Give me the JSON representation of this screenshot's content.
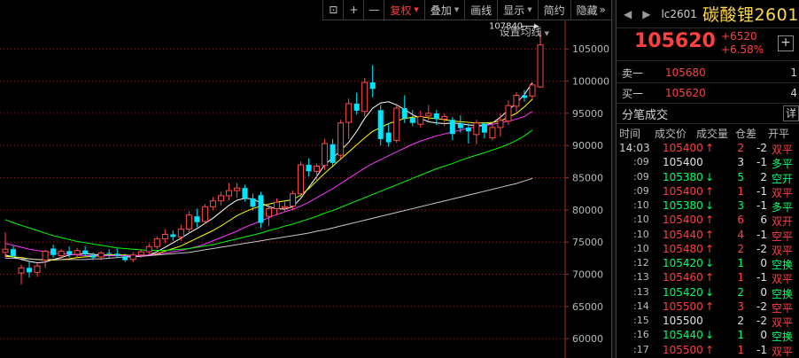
{
  "toolbar": {
    "items": [
      {
        "name": "lock-icon",
        "label": "⊡",
        "square": true
      },
      {
        "name": "zoom-in-button",
        "label": "+",
        "square": true
      },
      {
        "name": "zoom-out-button",
        "label": "—",
        "square": true
      },
      {
        "name": "adjust-dropdown",
        "label": "复权",
        "caret": true,
        "active": true
      },
      {
        "name": "overlay-dropdown",
        "label": "叠加",
        "caret": true
      },
      {
        "name": "draw-button",
        "label": "画线"
      },
      {
        "name": "display-dropdown",
        "label": "显示",
        "caret": true
      },
      {
        "name": "contract-button",
        "label": "简约"
      },
      {
        "name": "hide-button",
        "label": "隐藏",
        "chevrons": "»"
      }
    ]
  },
  "chart": {
    "ma_settings_label": "设置均线",
    "peak_label": "107840",
    "price_ticks": [
      "105000",
      "100000",
      "95000",
      "90000",
      "85000",
      "80000",
      "75000",
      "70000",
      "65000",
      "60000"
    ]
  },
  "chart_data": {
    "type": "candlestick",
    "y_range": [
      57000,
      111500
    ],
    "colors": {
      "up": "#ff4b4b",
      "down": "#00e5ff",
      "ma5": "#ffffff",
      "ma10": "#ffff00",
      "ma20": "#ff33ff",
      "ma40": "#00ff00",
      "ma60": "#c8c8c8",
      "grid": "#8a2a2a"
    },
    "candles": [
      {
        "o": 73400,
        "h": 76500,
        "l": 72500,
        "c": 73900
      },
      {
        "o": 73900,
        "h": 74400,
        "l": 72600,
        "c": 72800
      },
      {
        "o": 70200,
        "h": 71500,
        "l": 68400,
        "c": 71000
      },
      {
        "o": 71000,
        "h": 72000,
        "l": 69500,
        "c": 70300
      },
      {
        "o": 70300,
        "h": 71800,
        "l": 69600,
        "c": 71300
      },
      {
        "o": 72200,
        "h": 73800,
        "l": 71000,
        "c": 73600
      },
      {
        "o": 74000,
        "h": 74600,
        "l": 72600,
        "c": 73000
      },
      {
        "o": 72900,
        "h": 73900,
        "l": 72200,
        "c": 73600
      },
      {
        "o": 73600,
        "h": 74300,
        "l": 72600,
        "c": 73100
      },
      {
        "o": 73100,
        "h": 74100,
        "l": 72700,
        "c": 73700
      },
      {
        "o": 73700,
        "h": 74400,
        "l": 72800,
        "c": 73100
      },
      {
        "o": 73000,
        "h": 73400,
        "l": 72200,
        "c": 72600
      },
      {
        "o": 72700,
        "h": 73600,
        "l": 72200,
        "c": 73300
      },
      {
        "o": 73300,
        "h": 73900,
        "l": 72600,
        "c": 73200
      },
      {
        "o": 73200,
        "h": 74000,
        "l": 72600,
        "c": 72900
      },
      {
        "o": 72800,
        "h": 73200,
        "l": 71900,
        "c": 72200
      },
      {
        "o": 72300,
        "h": 73400,
        "l": 71900,
        "c": 73000
      },
      {
        "o": 73000,
        "h": 73900,
        "l": 72600,
        "c": 73500
      },
      {
        "o": 73500,
        "h": 74800,
        "l": 73000,
        "c": 74300
      },
      {
        "o": 74300,
        "h": 75900,
        "l": 73900,
        "c": 75500
      },
      {
        "o": 75500,
        "h": 77000,
        "l": 74800,
        "c": 76200
      },
      {
        "o": 76200,
        "h": 76800,
        "l": 75200,
        "c": 75800
      },
      {
        "o": 75800,
        "h": 77700,
        "l": 75200,
        "c": 77000
      },
      {
        "o": 77000,
        "h": 79800,
        "l": 76400,
        "c": 79200
      },
      {
        "o": 79000,
        "h": 80200,
        "l": 77300,
        "c": 78100
      },
      {
        "o": 78200,
        "h": 80900,
        "l": 77800,
        "c": 80500
      },
      {
        "o": 80500,
        "h": 82000,
        "l": 79900,
        "c": 81400
      },
      {
        "o": 81400,
        "h": 82800,
        "l": 80700,
        "c": 82200
      },
      {
        "o": 82200,
        "h": 84200,
        "l": 81500,
        "c": 83000
      },
      {
        "o": 83000,
        "h": 84200,
        "l": 81900,
        "c": 83400
      },
      {
        "o": 83400,
        "h": 83900,
        "l": 81300,
        "c": 81800
      },
      {
        "o": 81800,
        "h": 82500,
        "l": 79900,
        "c": 80500
      },
      {
        "o": 82300,
        "h": 82800,
        "l": 77200,
        "c": 78000
      },
      {
        "o": 79000,
        "h": 81000,
        "l": 77500,
        "c": 80200
      },
      {
        "o": 80200,
        "h": 81800,
        "l": 79200,
        "c": 81200
      },
      {
        "o": 80300,
        "h": 81300,
        "l": 79700,
        "c": 80500
      },
      {
        "o": 80600,
        "h": 83000,
        "l": 79900,
        "c": 82500
      },
      {
        "o": 82500,
        "h": 87500,
        "l": 82000,
        "c": 87000
      },
      {
        "o": 87000,
        "h": 88000,
        "l": 85200,
        "c": 86000
      },
      {
        "o": 86000,
        "h": 87200,
        "l": 84400,
        "c": 86800
      },
      {
        "o": 86900,
        "h": 91000,
        "l": 86200,
        "c": 90300
      },
      {
        "o": 90200,
        "h": 91000,
        "l": 86600,
        "c": 87300
      },
      {
        "o": 88500,
        "h": 94000,
        "l": 88000,
        "c": 93500
      },
      {
        "o": 93600,
        "h": 97300,
        "l": 91000,
        "c": 96500
      },
      {
        "o": 96500,
        "h": 98200,
        "l": 94800,
        "c": 95400
      },
      {
        "o": 95300,
        "h": 100500,
        "l": 94500,
        "c": 99800
      },
      {
        "o": 99800,
        "h": 102500,
        "l": 97500,
        "c": 98800
      },
      {
        "o": 95500,
        "h": 96300,
        "l": 90000,
        "c": 91000
      },
      {
        "o": 92000,
        "h": 93500,
        "l": 89800,
        "c": 90500
      },
      {
        "o": 90800,
        "h": 96500,
        "l": 90400,
        "c": 95800
      },
      {
        "o": 95800,
        "h": 97800,
        "l": 93500,
        "c": 94200
      },
      {
        "o": 94300,
        "h": 95500,
        "l": 93000,
        "c": 93500
      },
      {
        "o": 93300,
        "h": 95400,
        "l": 92800,
        "c": 94500
      },
      {
        "o": 94600,
        "h": 96300,
        "l": 93900,
        "c": 95000
      },
      {
        "o": 95000,
        "h": 95500,
        "l": 93200,
        "c": 94100
      },
      {
        "o": 94100,
        "h": 95000,
        "l": 93000,
        "c": 94500
      },
      {
        "o": 94000,
        "h": 94400,
        "l": 90800,
        "c": 91800
      },
      {
        "o": 93400,
        "h": 94700,
        "l": 92000,
        "c": 92700
      },
      {
        "o": 92800,
        "h": 93400,
        "l": 90300,
        "c": 92200
      },
      {
        "o": 91700,
        "h": 94000,
        "l": 90200,
        "c": 93500
      },
      {
        "o": 93400,
        "h": 93600,
        "l": 91100,
        "c": 92000
      },
      {
        "o": 91200,
        "h": 93700,
        "l": 90800,
        "c": 92800
      },
      {
        "o": 92800,
        "h": 95000,
        "l": 91400,
        "c": 93900
      },
      {
        "o": 93800,
        "h": 97000,
        "l": 93200,
        "c": 96200
      },
      {
        "o": 96100,
        "h": 98300,
        "l": 95200,
        "c": 97800
      },
      {
        "o": 97800,
        "h": 98600,
        "l": 96800,
        "c": 97400
      },
      {
        "o": 97700,
        "h": 99800,
        "l": 97200,
        "c": 99400
      },
      {
        "o": 99100,
        "h": 107840,
        "l": 99000,
        "c": 105620
      }
    ],
    "ma": {
      "ma5": [
        73000,
        72700,
        72300,
        72000,
        71800,
        71900,
        72300,
        72600,
        73000,
        73100,
        73200,
        73100,
        73000,
        73000,
        73000,
        72900,
        72800,
        72800,
        73000,
        73500,
        74200,
        74900,
        75600,
        76400,
        77100,
        77900,
        78700,
        79700,
        80700,
        81500,
        81800,
        81700,
        81100,
        80500,
        80200,
        80100,
        80500,
        81800,
        83500,
        85200,
        87000,
        88100,
        89200,
        90500,
        92200,
        94200,
        95800,
        96600,
        96800,
        96300,
        95600,
        94800,
        94200,
        93700,
        93500,
        93400,
        93500,
        93400,
        93200,
        93100,
        93200,
        93500,
        94400,
        95500,
        96600,
        97900,
        99800
      ],
      "ma10": [
        72800,
        72700,
        72600,
        72400,
        72300,
        72200,
        72200,
        72300,
        72400,
        72600,
        72700,
        72800,
        72900,
        73000,
        73000,
        73000,
        72900,
        72900,
        73000,
        73200,
        73600,
        74000,
        74400,
        75000,
        75600,
        76200,
        76800,
        77500,
        78300,
        79100,
        79700,
        80200,
        80600,
        80900,
        81200,
        81400,
        81600,
        82300,
        83300,
        84500,
        85700,
        86800,
        87900,
        89000,
        90100,
        91200,
        92200,
        92800,
        93400,
        93800,
        94200,
        94400,
        94500,
        94300,
        94200,
        94000,
        93800,
        93700,
        93600,
        93500,
        93500,
        93600,
        93800,
        94400,
        95000,
        96000,
        97200
      ],
      "ma20": [
        74800,
        74500,
        74200,
        73900,
        73700,
        73500,
        73300,
        73200,
        73100,
        73000,
        72900,
        72900,
        72900,
        72900,
        72900,
        72900,
        72900,
        72900,
        73000,
        73100,
        73300,
        73500,
        73700,
        74000,
        74300,
        74700,
        75200,
        75700,
        76200,
        76700,
        77300,
        77800,
        78300,
        78800,
        79300,
        79700,
        80100,
        80600,
        81200,
        81900,
        82600,
        83300,
        84100,
        84900,
        85700,
        86500,
        87200,
        87800,
        88400,
        89000,
        89600,
        90200,
        90700,
        91100,
        91500,
        91800,
        92100,
        92400,
        92700,
        92900,
        93100,
        93300,
        93500,
        93800,
        94100,
        94500,
        95300
      ],
      "ma40": [
        78500,
        78000,
        77600,
        77200,
        76800,
        76400,
        76000,
        75700,
        75400,
        75100,
        74900,
        74700,
        74500,
        74300,
        74100,
        74000,
        73900,
        73800,
        73700,
        73700,
        73700,
        73800,
        73900,
        74000,
        74200,
        74400,
        74600,
        74900,
        75200,
        75500,
        75800,
        76100,
        76400,
        76800,
        77100,
        77500,
        77800,
        78200,
        78600,
        79000,
        79500,
        79900,
        80400,
        80900,
        81400,
        81900,
        82400,
        82900,
        83400,
        83900,
        84400,
        84900,
        85400,
        85900,
        86400,
        86800,
        87200,
        87700,
        88100,
        88500,
        88900,
        89300,
        89700,
        90200,
        90800,
        91500,
        92400
      ],
      "ma60": [
        72500,
        72500,
        72400,
        72400,
        72300,
        72300,
        72300,
        72300,
        72300,
        72300,
        72300,
        72400,
        72400,
        72500,
        72600,
        72700,
        72700,
        72800,
        72900,
        73000,
        73100,
        73200,
        73300,
        73400,
        73600,
        73800,
        74000,
        74200,
        74400,
        74600,
        74800,
        75000,
        75200,
        75400,
        75600,
        75800,
        76000,
        76200,
        76400,
        76700,
        76900,
        77200,
        77500,
        77800,
        78100,
        78400,
        78700,
        79000,
        79300,
        79600,
        79900,
        80200,
        80500,
        80800,
        81100,
        81400,
        81700,
        82000,
        82300,
        82600,
        82900,
        83200,
        83500,
        83800,
        84100,
        84500,
        84900
      ]
    }
  },
  "quote": {
    "nav_prev": "◀",
    "nav_next": "▶",
    "code": "lc2601",
    "name": "碳酸锂2601",
    "last": "105620",
    "change": "+6520",
    "change_pct": "+6.58%",
    "add_label": "+",
    "orderbook": {
      "sell": {
        "label": "卖一",
        "price": "105680",
        "vol": "1"
      },
      "buy": {
        "label": "买一",
        "price": "105620",
        "vol": "4"
      }
    }
  },
  "trades": {
    "title": "分笔成交",
    "detail_label": "详",
    "columns": [
      "时间",
      "成交价",
      "成交量",
      "仓差",
      "开平"
    ],
    "rows": [
      {
        "time": "14:03",
        "price": "105400",
        "dir": "up",
        "vol": "2",
        "oi": "-2",
        "nature": "双平",
        "nc": "up"
      },
      {
        "time": ":09",
        "price": "105400",
        "dir": "",
        "vol": "3",
        "oi": "-1",
        "nature": "多平",
        "nc": "down"
      },
      {
        "time": ":09",
        "price": "105380",
        "dir": "down",
        "vol": "5",
        "oi": "2",
        "nature": "空开",
        "nc": "down"
      },
      {
        "time": ":09",
        "price": "105400",
        "dir": "up",
        "vol": "1",
        "oi": "-1",
        "nature": "双平",
        "nc": "up"
      },
      {
        "time": ":10",
        "price": "105380",
        "dir": "down",
        "vol": "3",
        "oi": "-1",
        "nature": "多平",
        "nc": "down"
      },
      {
        "time": ":10",
        "price": "105400",
        "dir": "up",
        "vol": "6",
        "oi": "6",
        "nature": "双开",
        "nc": "up"
      },
      {
        "time": ":10",
        "price": "105440",
        "dir": "up",
        "vol": "4",
        "oi": "-1",
        "nature": "空平",
        "nc": "up"
      },
      {
        "time": ":10",
        "price": "105480",
        "dir": "up",
        "vol": "2",
        "oi": "-2",
        "nature": "双平",
        "nc": "up"
      },
      {
        "time": ":12",
        "price": "105420",
        "dir": "down",
        "vol": "1",
        "oi": "0",
        "nature": "空换",
        "nc": "down"
      },
      {
        "time": ":13",
        "price": "105460",
        "dir": "up",
        "vol": "1",
        "oi": "-1",
        "nature": "双平",
        "nc": "up"
      },
      {
        "time": ":13",
        "price": "105420",
        "dir": "down",
        "vol": "2",
        "oi": "0",
        "nature": "空换",
        "nc": "down"
      },
      {
        "time": ":14",
        "price": "105500",
        "dir": "up",
        "vol": "3",
        "oi": "-2",
        "nature": "空平",
        "nc": "up"
      },
      {
        "time": ":15",
        "price": "105500",
        "dir": "",
        "vol": "2",
        "oi": "-2",
        "nature": "双平",
        "nc": "up"
      },
      {
        "time": ":16",
        "price": "105440",
        "dir": "down",
        "vol": "1",
        "oi": "0",
        "nature": "空换",
        "nc": "down"
      },
      {
        "time": ":17",
        "price": "105500",
        "dir": "up",
        "vol": "1",
        "oi": "-1",
        "nature": "双平",
        "nc": "up"
      }
    ]
  }
}
